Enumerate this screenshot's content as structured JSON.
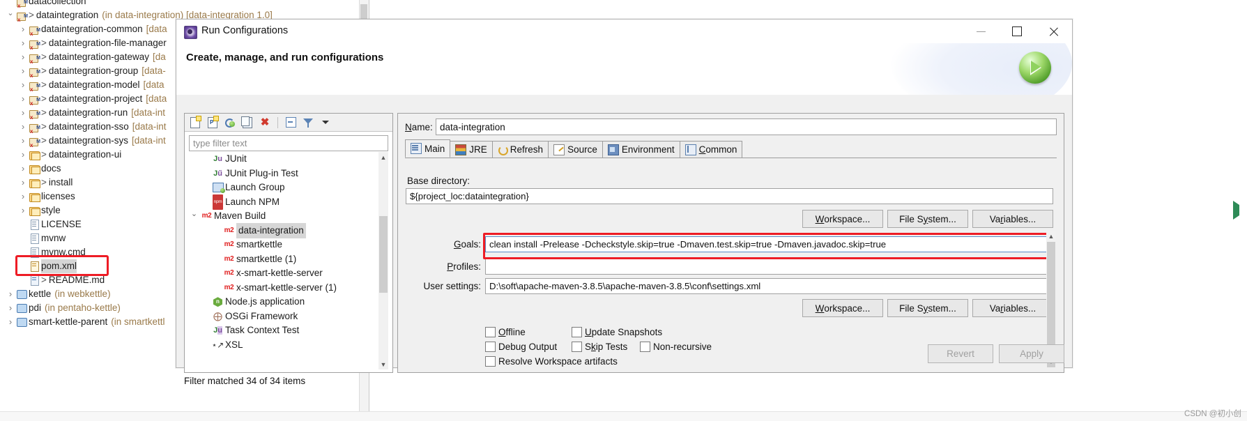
{
  "ide": {
    "tree": [
      {
        "indent": 0,
        "twist": "none",
        "icon": "maven-project-icon",
        "label": "datacollection",
        "arrow": false,
        "suffix": "",
        "clipped": true
      },
      {
        "indent": 0,
        "twist": "open",
        "icon": "maven-project-icon",
        "label": "dataintegration",
        "arrow": true,
        "suffix": "(in data-integration) [data-integration 1.0]"
      },
      {
        "indent": 1,
        "twist": "closed",
        "icon": "maven-project-icon",
        "label": "dataintegration-common",
        "arrow": false,
        "suffix": "[data"
      },
      {
        "indent": 1,
        "twist": "closed",
        "icon": "maven-project-icon",
        "label": "dataintegration-file-manager",
        "arrow": true,
        "suffix": ""
      },
      {
        "indent": 1,
        "twist": "closed",
        "icon": "maven-project-icon",
        "label": "dataintegration-gateway",
        "arrow": true,
        "suffix": "[da"
      },
      {
        "indent": 1,
        "twist": "closed",
        "icon": "maven-project-icon",
        "label": "dataintegration-group",
        "arrow": true,
        "suffix": "[data-"
      },
      {
        "indent": 1,
        "twist": "closed",
        "icon": "maven-project-icon",
        "label": "dataintegration-model",
        "arrow": true,
        "suffix": "[data"
      },
      {
        "indent": 1,
        "twist": "closed",
        "icon": "maven-project-icon",
        "label": "dataintegration-project",
        "arrow": true,
        "suffix": "[data"
      },
      {
        "indent": 1,
        "twist": "closed",
        "icon": "maven-project-icon",
        "label": "dataintegration-run",
        "arrow": true,
        "suffix": "[data-int"
      },
      {
        "indent": 1,
        "twist": "closed",
        "icon": "maven-project-icon",
        "label": "dataintegration-sso",
        "arrow": true,
        "suffix": "[data-int"
      },
      {
        "indent": 1,
        "twist": "closed",
        "icon": "maven-project-icon",
        "label": "dataintegration-sys",
        "arrow": true,
        "suffix": "[data-int"
      },
      {
        "indent": 1,
        "twist": "closed",
        "icon": "folder-icon",
        "label": "dataintegration-ui",
        "arrow": true,
        "suffix": ""
      },
      {
        "indent": 1,
        "twist": "closed",
        "icon": "folder-icon",
        "label": "docs",
        "arrow": false,
        "suffix": ""
      },
      {
        "indent": 1,
        "twist": "closed",
        "icon": "folder-icon",
        "label": "install",
        "arrow": true,
        "suffix": ""
      },
      {
        "indent": 1,
        "twist": "closed",
        "icon": "folder-icon",
        "label": "licenses",
        "arrow": false,
        "suffix": ""
      },
      {
        "indent": 1,
        "twist": "closed",
        "icon": "folder-icon",
        "label": "style",
        "arrow": false,
        "suffix": ""
      },
      {
        "indent": 1,
        "twist": "none",
        "icon": "file-icon",
        "label": "LICENSE",
        "arrow": false,
        "suffix": ""
      },
      {
        "indent": 1,
        "twist": "none",
        "icon": "file-icon",
        "label": "mvnw",
        "arrow": false,
        "suffix": ""
      },
      {
        "indent": 1,
        "twist": "none",
        "icon": "file-icon",
        "label": "mvnw.cmd",
        "arrow": false,
        "suffix": ""
      },
      {
        "indent": 1,
        "twist": "none",
        "icon": "pom-xml-icon",
        "label": "pom.xml",
        "arrow": false,
        "suffix": "",
        "selected": true,
        "highlighted": true
      },
      {
        "indent": 1,
        "twist": "none",
        "icon": "markdown-file-icon",
        "label": "README.md",
        "arrow": true,
        "suffix": ""
      },
      {
        "indent": 0,
        "twist": "closed",
        "icon": "project-icon",
        "label": "kettle",
        "arrow": false,
        "suffix": "(in webkettle)"
      },
      {
        "indent": 0,
        "twist": "closed",
        "icon": "project-icon",
        "label": "pdi",
        "arrow": false,
        "suffix": "(in pentaho-kettle)"
      },
      {
        "indent": 0,
        "twist": "closed",
        "icon": "project-icon",
        "label": "smart-kettle-parent",
        "arrow": false,
        "suffix": "(in smartkettl"
      }
    ]
  },
  "dialog": {
    "title": "Run Configurations",
    "header_title": "Create, manage, and run configurations",
    "window_buttons": {
      "minimize": "minimize-button",
      "maximize": "maximize-button",
      "close": "close-button"
    },
    "toolbar": [
      {
        "name": "new-configuration-icon"
      },
      {
        "name": "new-prototype-icon"
      },
      {
        "name": "export-icon"
      },
      {
        "name": "duplicate-icon"
      },
      {
        "name": "delete-icon"
      },
      {
        "name": "collapse-all-icon"
      },
      {
        "name": "filter-icon"
      },
      {
        "name": "view-menu-icon"
      }
    ],
    "filter_placeholder": "type filter text",
    "config_tree": [
      {
        "indent": 1,
        "twist": "none",
        "icon": "junit-icon",
        "label": "JUnit"
      },
      {
        "indent": 1,
        "twist": "none",
        "icon": "junit-plugin-icon",
        "label": "JUnit Plug-in Test"
      },
      {
        "indent": 1,
        "twist": "none",
        "icon": "launch-group-icon",
        "label": "Launch Group"
      },
      {
        "indent": 1,
        "twist": "none",
        "icon": "npm-icon",
        "label": "Launch NPM"
      },
      {
        "indent": 0,
        "twist": "open",
        "icon": "maven-icon",
        "label": "Maven Build"
      },
      {
        "indent": 2,
        "twist": "none",
        "icon": "maven-icon",
        "label": "data-integration",
        "selected": true
      },
      {
        "indent": 2,
        "twist": "none",
        "icon": "maven-icon",
        "label": "smartkettle"
      },
      {
        "indent": 2,
        "twist": "none",
        "icon": "maven-icon",
        "label": "smartkettle (1)"
      },
      {
        "indent": 2,
        "twist": "none",
        "icon": "maven-icon",
        "label": "x-smart-kettle-server"
      },
      {
        "indent": 2,
        "twist": "none",
        "icon": "maven-icon",
        "label": "x-smart-kettle-server (1)"
      },
      {
        "indent": 1,
        "twist": "none",
        "icon": "nodejs-icon",
        "label": "Node.js application"
      },
      {
        "indent": 1,
        "twist": "none",
        "icon": "osgi-icon",
        "label": "OSGi Framework"
      },
      {
        "indent": 1,
        "twist": "none",
        "icon": "junit-task-icon",
        "label": "Task Context Test"
      },
      {
        "indent": 1,
        "twist": "none",
        "icon": "xsl-icon",
        "label": "XSL"
      }
    ],
    "filter_status": "Filter matched 34 of 34 items",
    "name_label": "Name:",
    "name_value": "data-integration",
    "tabs": [
      {
        "label": "Main",
        "icon": "main-tab-icon",
        "active": true
      },
      {
        "label": "JRE",
        "icon": "jre-tab-icon",
        "active": false
      },
      {
        "label": "Refresh",
        "icon": "refresh-tab-icon",
        "active": false
      },
      {
        "label": "Source",
        "icon": "source-tab-icon",
        "active": false
      },
      {
        "label": "Environment",
        "icon": "environment-tab-icon",
        "active": false
      },
      {
        "label": "Common",
        "icon": "common-tab-icon",
        "active": false
      }
    ],
    "main_tab": {
      "base_directory_label": "Base directory:",
      "base_directory_value": "${project_loc:dataintegration}",
      "buttons_row1": [
        "Workspace...",
        "File System...",
        "Variables..."
      ],
      "goals_label": "Goals:",
      "goals_value": "clean install -Prelease  -Dcheckstyle.skip=true -Dmaven.test.skip=true -Dmaven.javadoc.skip=true",
      "profiles_label": "Profiles:",
      "profiles_value": "",
      "user_settings_label": "User settings:",
      "user_settings_value": "D:\\soft\\apache-maven-3.8.5\\apache-maven-3.8.5\\conf\\settings.xml",
      "buttons_row2": [
        "Workspace...",
        "File System...",
        "Variables..."
      ],
      "checkboxes": [
        {
          "label": "Offline",
          "checked": false
        },
        {
          "label": "Update Snapshots",
          "checked": false
        },
        {
          "label": "Debug Output",
          "checked": false
        },
        {
          "label": "Skip Tests",
          "checked": false
        },
        {
          "label": "Non-recursive",
          "checked": false
        },
        {
          "label": "Resolve Workspace artifacts",
          "checked": false
        }
      ]
    },
    "footer": {
      "revert": "Revert",
      "apply": "Apply"
    }
  },
  "annotations": {
    "highlight_color": "#ee1c25",
    "pom_highlight_target": "pom.xml",
    "goals_highlight_target": "Goals field"
  },
  "watermark": "CSDN @初小创"
}
